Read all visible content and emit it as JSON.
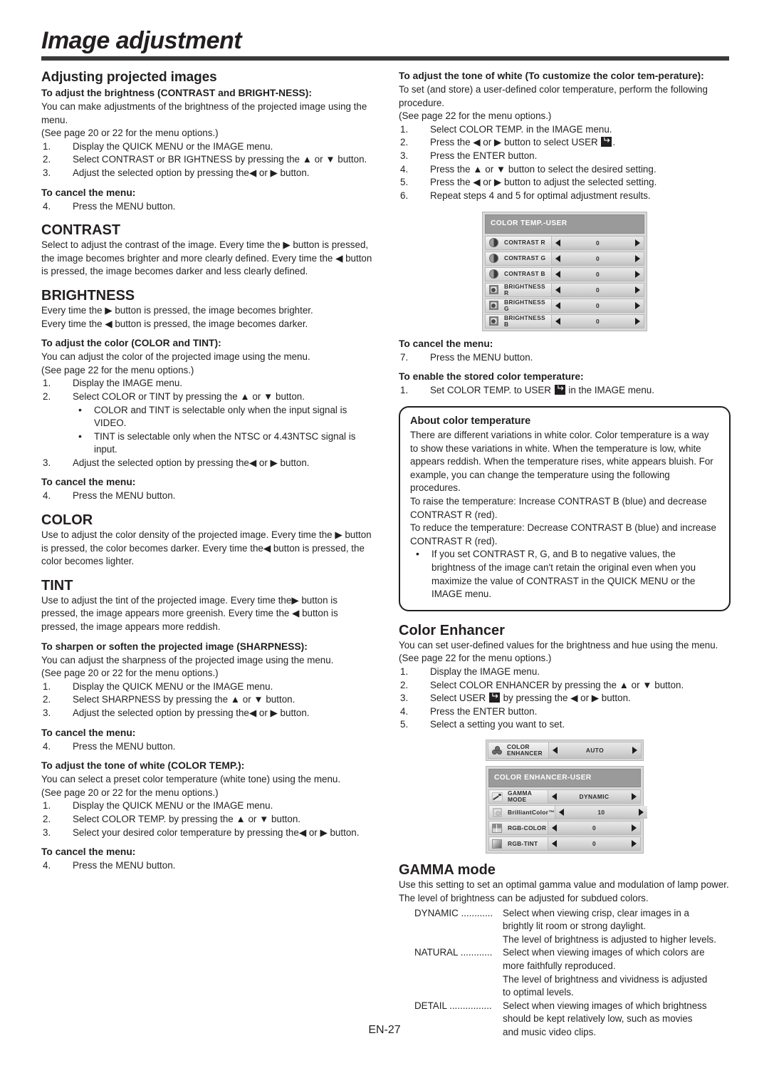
{
  "page": {
    "title": "Image adjustment",
    "footer": "EN-27"
  },
  "left_column": {
    "section1": {
      "heading": "Adjusting projected images",
      "sub1": "To adjust the brightness (CONTRAST and BRIGHT-NESS):",
      "p1": "You can make adjustments of the brightness of the projected image using the menu.",
      "p2": "(See page 20 or 22 for the menu options.)",
      "steps": [
        {
          "num": "1.",
          "text": "Display the QUICK MENU or the IMAGE menu."
        },
        {
          "num": "2.",
          "text": "Select CONTRAST or BR IGHTNESS by pressing the ▲ or ▼ button."
        },
        {
          "num": "3.",
          "text": "Adjust the selected option by pressing the◀ or ▶ button."
        }
      ],
      "cancel_heading": "To cancel the menu:",
      "cancel_step": {
        "num": "4.",
        "text": "Press the MENU button."
      }
    },
    "contrast": {
      "heading": "CONTRAST",
      "body": "Select to adjust the contrast of the image. Every time the ▶ button is pressed, the image becomes brighter and more clearly defined. Every time the ◀ button is pressed, the image becomes darker and less clearly defined."
    },
    "brightness": {
      "heading": "BRIGHTNESS",
      "line1": "Every time the ▶ button is pressed, the image becomes brighter.",
      "line2": "Every time the ◀ button is pressed, the image becomes darker."
    },
    "color_tint": {
      "sub": "To adjust the color (COLOR and TINT):",
      "p1": "You can adjust the color of the projected image using the menu.",
      "p2": "(See page 22 for the menu options.)",
      "steps": [
        {
          "num": "1.",
          "text": "Display the IMAGE menu."
        },
        {
          "num": "2.",
          "text": "Select COLOR or TINT by pressing the ▲ or ▼ button."
        }
      ],
      "bullets": [
        "COLOR and TINT is selectable only when the input signal is VIDEO.",
        "TINT is selectable only when the NTSC or 4.43NTSC signal is input."
      ],
      "step3": {
        "num": "3.",
        "text": "Adjust the selected option by pressing the◀ or ▶ button."
      },
      "cancel_heading": "To cancel the menu:",
      "cancel_step": {
        "num": "4.",
        "text": "Press the MENU button."
      }
    },
    "color": {
      "heading": "COLOR",
      "body": "Use to adjust the color density of the projected image. Every time the ▶ button is pressed, the color becomes darker. Every time the◀ button is pressed, the color becomes lighter."
    },
    "tint": {
      "heading": "TINT",
      "body": "Use to adjust the tint of the projected image. Every time the▶ button is pressed, the image appears more greenish. Every time the ◀ button is pressed, the image appears more reddish."
    },
    "sharpness": {
      "sub": "To sharpen or soften the projected image (SHARPNESS):",
      "p1": "You can adjust the sharpness of the projected image using the menu.",
      "p2": "(See page 20 or 22 for the menu options.)",
      "steps": [
        {
          "num": "1.",
          "text": "Display the QUICK MENU or the IMAGE menu."
        },
        {
          "num": "2.",
          "text": "Select SHARPNESS by pressing the ▲ or ▼ button."
        },
        {
          "num": "3.",
          "text": "Adjust the selected option by pressing the◀ or ▶ button."
        }
      ],
      "cancel_heading": "To cancel the menu:",
      "cancel_step": {
        "num": "4.",
        "text": "Press the MENU button."
      }
    },
    "color_temp": {
      "sub": "To adjust the tone of white (COLOR TEMP.):",
      "p1": "You can select a preset color temperature (white tone) using the menu.",
      "p2": "(See page 20 or 22 for the menu options.)",
      "steps": [
        {
          "num": "1.",
          "text": "Display the QUICK MENU or the IMAGE menu."
        },
        {
          "num": "2.",
          "text": "Select COLOR TEMP. by pressing the ▲ or ▼ button."
        },
        {
          "num": "3.",
          "text": "Select your desired color temperature by pressing the◀ or ▶ button."
        }
      ],
      "cancel_heading": "To cancel the menu:",
      "cancel_step": {
        "num": "4.",
        "text": "Press the MENU button."
      }
    }
  },
  "right_column": {
    "customize": {
      "sub": "To adjust the tone of white (To customize the color tem-perature):",
      "p1": "To set (and store) a user-defined color temperature, perform the following procedure.",
      "p2": "(See page 22 for the menu options.)",
      "steps": [
        {
          "num": "1.",
          "text": "Select COLOR TEMP. in the IMAGE menu."
        },
        {
          "num": "2.",
          "pre": "Press the ◀ or ▶ button to select USER ",
          "post": "."
        },
        {
          "num": "3.",
          "text": "Press the ENTER button."
        },
        {
          "num": "4.",
          "text": "Press the ▲ or ▼ button to select the desired setting."
        },
        {
          "num": "5.",
          "text": "Press the ◀ or ▶ button to adjust the selected setting."
        },
        {
          "num": "6.",
          "text": "Repeat steps 4 and 5 for optimal adjustment results."
        }
      ],
      "cancel_heading": "To cancel the menu:",
      "cancel_step": {
        "num": "7.",
        "text": "Press the MENU button."
      },
      "enable_heading": "To enable the stored color temperature:",
      "enable_step": {
        "num": "1.",
        "pre": "Set COLOR TEMP. to USER ",
        "post": " in the IMAGE menu."
      }
    },
    "osd_color_temp_user": {
      "title": "COLOR TEMP.-USER",
      "rows": [
        {
          "icon": "contrast-icon",
          "label": "CONTRAST R",
          "value": "0"
        },
        {
          "icon": "contrast-icon",
          "label": "CONTRAST G",
          "value": "0"
        },
        {
          "icon": "contrast-icon",
          "label": "CONTRAST B",
          "value": "0"
        },
        {
          "icon": "brightness-icon",
          "label": "BRIGHTNESS R",
          "value": "0"
        },
        {
          "icon": "brightness-icon",
          "label": "BRIGHTNESS G",
          "value": "0"
        },
        {
          "icon": "brightness-icon",
          "label": "BRIGHTNESS B",
          "value": "0"
        }
      ]
    },
    "about_box": {
      "heading": "About color temperature",
      "p1": "There are different variations in white color. Color temperature is a way to show these variations in white. When the temperature is low, white appears reddish. When the temperature rises, white appears bluish. For example, you can change the temperature using the following procedures.",
      "p2": "To raise the temperature: Increase CONTRAST B (blue) and decrease CONTRAST R (red).",
      "p3": "To reduce the temperature: Decrease CONTRAST B (blue) and increase CONTRAST R (red).",
      "bullet": "If you set CONTRAST R, G, and B to negative values, the brightness of the image can't retain the original even when you maximize the value of CONTRAST in the QUICK MENU or the IMAGE menu."
    },
    "color_enhancer": {
      "heading": "Color Enhancer",
      "p1": "You can set user-defined values for the brightness and hue using the menu. (See page 22 for the menu options.)",
      "steps": [
        {
          "num": "1.",
          "text": "Display the IMAGE menu."
        },
        {
          "num": "2.",
          "text": "Select COLOR ENHANCER by pressing the ▲ or ▼ button."
        },
        {
          "num": "3.",
          "pre": "Select USER ",
          "post": " by pressing the ◀ or ▶ button."
        },
        {
          "num": "4.",
          "text": "Press the ENTER button."
        },
        {
          "num": "5.",
          "text": "Select a setting you want to set."
        }
      ]
    },
    "osd_color_enhancer": {
      "single_row": {
        "icon": "color-enhancer-icon",
        "label_line1": "COLOR",
        "label_line2": "ENHANCER",
        "value": "AUTO"
      },
      "title": "COLOR ENHANCER-USER",
      "rows": [
        {
          "icon": "gamma-icon",
          "label": "GAMMA MODE",
          "value": "DYNAMIC"
        },
        {
          "icon": "brilliant-color-icon",
          "label": "BrilliantColor™",
          "value": "10"
        },
        {
          "icon": "rgb-color-icon",
          "label": "RGB-COLOR",
          "value": "0"
        },
        {
          "icon": "rgb-tint-icon",
          "label": "RGB-TINT",
          "value": "0"
        }
      ]
    },
    "gamma_mode": {
      "heading": "GAMMA mode",
      "p1": "Use this setting to set an optimal gamma value and modulation of lamp power. The level of brightness can be adjusted for subdued colors.",
      "defs": [
        {
          "term": "DYNAMIC ............",
          "lines": [
            "Select when viewing crisp, clear images in a",
            "brightly lit room or strong daylight.",
            "The level of brightness is adjusted to higher levels."
          ]
        },
        {
          "term": "NATURAL ............",
          "lines": [
            "Select when viewing images of which colors are",
            "more faithfully reproduced.",
            "The level of brightness and vividness is adjusted",
            "to optimal levels."
          ]
        },
        {
          "term": "DETAIL ................",
          "lines": [
            "Select when viewing images of which brightness",
            "should be kept relatively low, such as movies",
            "and music video clips."
          ]
        }
      ]
    }
  }
}
